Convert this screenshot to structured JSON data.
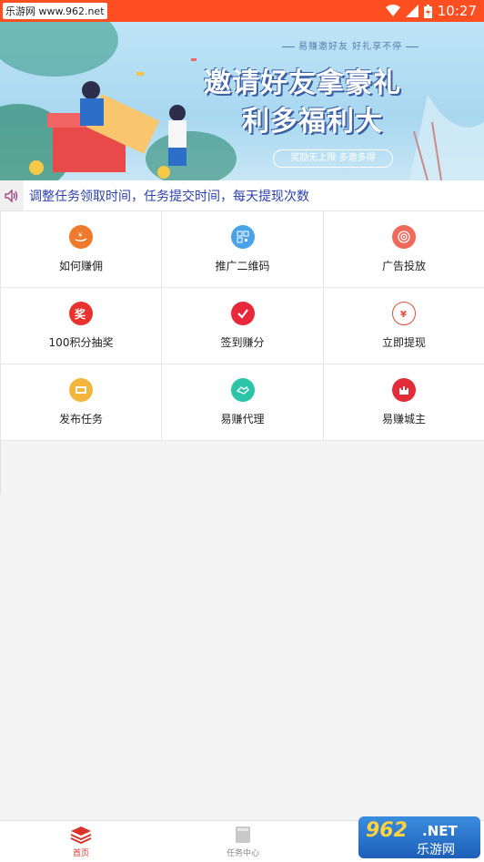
{
  "statusbar": {
    "watermark": "乐游网 www.962.net",
    "time": "10:27",
    "battery_icon": "battery-icon",
    "wifi_icon": "wifi-icon",
    "signal_icon": "signal-icon"
  },
  "banner": {
    "small_slogan": "易赚邀好友 好礼享不停",
    "title_line1": "邀请好友拿豪礼",
    "title_line2": "利多福利大",
    "pill": "奖励无上限 多邀多得"
  },
  "notice": {
    "icon": "speaker-icon",
    "text": "调整任务领取时间，任务提交时间，每天提现次数"
  },
  "grid": {
    "items": [
      {
        "label": "如何赚佣",
        "icon": "hand-coin-icon",
        "color": "#f07a2c"
      },
      {
        "label": "推广二维码",
        "icon": "qrcode-icon",
        "color": "#4aa3e8"
      },
      {
        "label": "广告投放",
        "icon": "target-icon",
        "color": "#ef6a5b"
      },
      {
        "label": "100积分抽奖",
        "icon": "lottery-icon",
        "color": "#e8322e"
      },
      {
        "label": "签到赚分",
        "icon": "check-icon",
        "color": "#e8283a"
      },
      {
        "label": "立即提现",
        "icon": "yuan-cycle-icon",
        "color": "#e64b3b"
      },
      {
        "label": "发布任务",
        "icon": "ticket-icon",
        "color": "#f2b63c"
      },
      {
        "label": "易赚代理",
        "icon": "handshake-icon",
        "color": "#2cc4a8"
      },
      {
        "label": "易赚城主",
        "icon": "castle-icon",
        "color": "#e22c3a"
      }
    ]
  },
  "tabbar": {
    "tabs": [
      {
        "label": "首页",
        "icon": "layers-icon",
        "active": true
      },
      {
        "label": "任务中心",
        "icon": "book-icon",
        "active": false
      }
    ]
  },
  "site_watermark": {
    "top": "962",
    "net": ".NET",
    "bottom": "乐游网"
  }
}
